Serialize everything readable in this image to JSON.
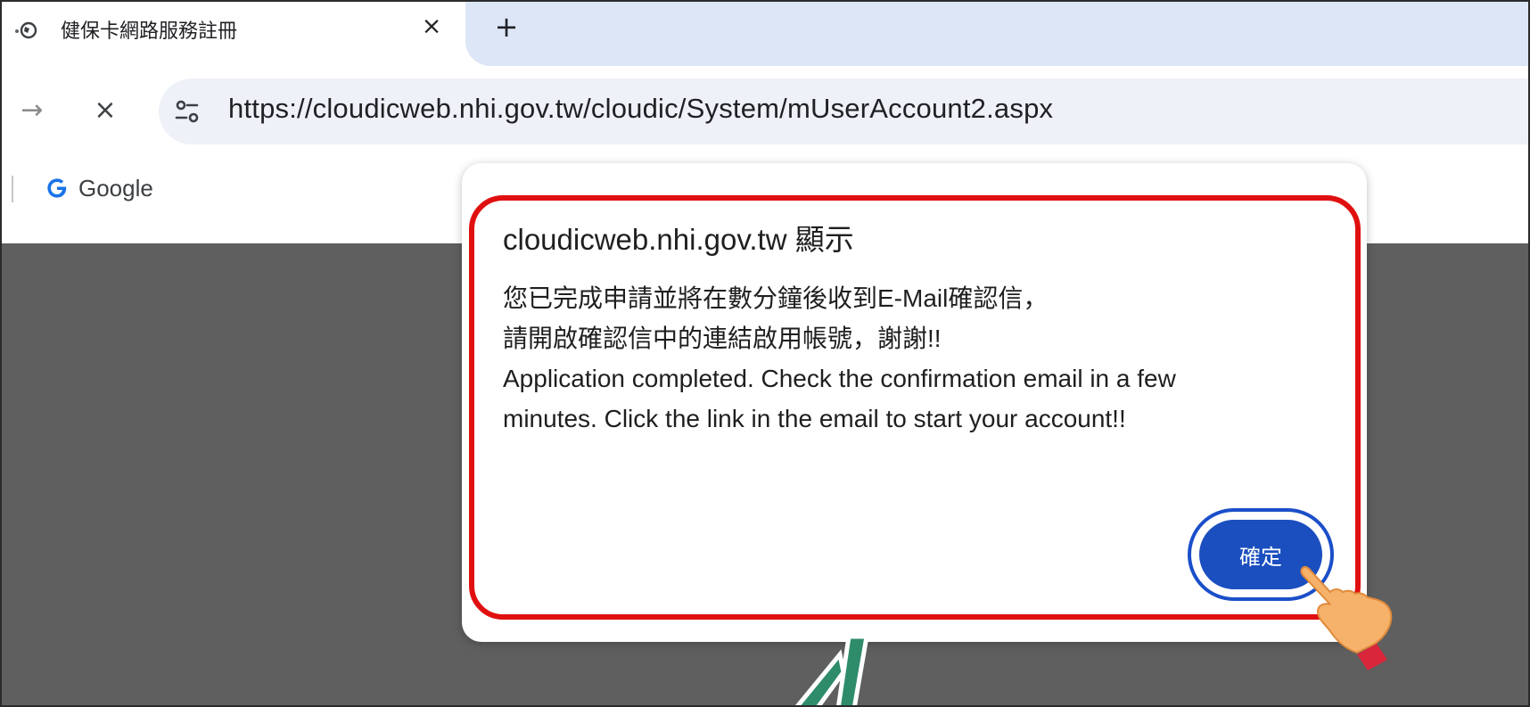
{
  "browser": {
    "tab": {
      "title": "健保卡網路服務註冊",
      "close_glyph": "×"
    },
    "new_tab_glyph": "+",
    "toolbar": {
      "forward_glyph": "→",
      "stop_glyph": "×",
      "url": "https://cloudicweb.nhi.gov.tw/cloudic/System/mUserAccount2.aspx"
    },
    "bookmarks": [
      {
        "label": "Google",
        "icon": "google-icon"
      }
    ]
  },
  "dialog": {
    "title": "cloudicweb.nhi.gov.tw 顯示",
    "message_lines": [
      "您已完成申請並將在數分鐘後收到E-Mail確認信，",
      "請開啟確認信中的連結啟用帳號，謝謝!!",
      "Application completed. Check the confirmation email in a few",
      "minutes. Click the link in the email to start your account!!"
    ],
    "ok_label": "確定"
  },
  "colors": {
    "highlight_border": "#e01010",
    "ok_button": "#1b4fbf",
    "page_backdrop": "#5f5f5f",
    "tabstrip": "#dde6f7"
  },
  "icons": [
    "globe-icon",
    "close-icon",
    "plus-icon",
    "forward-arrow-icon",
    "stop-icon",
    "site-settings-icon",
    "google-icon",
    "pointing-hand-icon"
  ]
}
